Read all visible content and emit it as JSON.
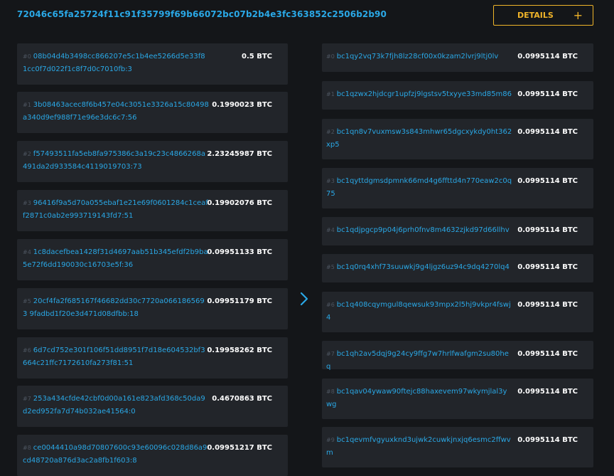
{
  "header": {
    "txid": "72046c65fa25724f11c91f35799f69b66072bc07b2b4e3fc363852c2506b2b90",
    "details_label": "DETAILS",
    "details_plus": "+"
  },
  "inputs": [
    {
      "idx": "#0",
      "ref": "08b04d4b3498cc866207e5c1b4ee5266d5e33f81cc0f7d022f1c8f7d0c7010fb:3",
      "amount": "0.5 BTC"
    },
    {
      "idx": "#1",
      "ref": "3b08463acec8f6b457e04c3051e3326a15c80498a340d9ef988f71e96e3dc6c7:56",
      "amount": "0.1990023 BTC"
    },
    {
      "idx": "#2",
      "ref": "f57493511fa5eb8fa975386c3a19c23c4866268a491da2d933584c4119019703:73",
      "amount": "2.23245987 BTC"
    },
    {
      "idx": "#3",
      "ref": "96416f9a5d70a055ebaf1e21e69f0601284c1ceaff2871c0ab2e993719143fd7:51",
      "amount": "0.19902076 BTC"
    },
    {
      "idx": "#4",
      "ref": "1c8dacefbea1428f31d4697aab51b345efdf2b9ba5e72f6dd190030c16703e5f:36",
      "amount": "0.09951133 BTC"
    },
    {
      "idx": "#5",
      "ref": "20cf4fa2f685167f46682dd30c7720a0661865693 9fadbd1f20e3d471d08dfbb:18",
      "amount": "0.09951179 BTC"
    },
    {
      "idx": "#6",
      "ref": "6d7cd752e301f106f51dd8951f7d18e604532bf3664c21ffc7172610fa273f81:51",
      "amount": "0.19958262 BTC"
    },
    {
      "idx": "#7",
      "ref": "253a434cfde42cbf0d00a161e823afd368c50da9d2ed952fa7d74b032ae41564:0",
      "amount": "0.4670863 BTC"
    },
    {
      "idx": "#8",
      "ref": "ce0044410a98d70807600c93e60096c028d86a9cd48720a876d3ac2a8fb1f603:8",
      "amount": "0.09951217 BTC"
    }
  ],
  "outputs": [
    {
      "idx": "#0",
      "ref": "bc1qy2vq73k7fjh8lz28cf00x0kzam2lvrj9ltj0lv",
      "amount": "0.0995114 BTC"
    },
    {
      "idx": "#1",
      "ref": "bc1qzwx2hjdcgr1upfzj9lgstsv5txyye33md85m86",
      "amount": "0.0995114 BTC"
    },
    {
      "idx": "#2",
      "ref": "bc1qn8v7vuxmsw3s843mhwr65dgcxykdy0ht362xp5",
      "amount": "0.0995114 BTC"
    },
    {
      "idx": "#3",
      "ref": "bc1qyttdgmsdpmnk66md4g6ffttd4n770eaw2c0q75",
      "amount": "0.0995114 BTC"
    },
    {
      "idx": "#4",
      "ref": "bc1qdjpgcp9p04j6prh0fnv8m4632zjkd97d66llhv",
      "amount": "0.0995114 BTC"
    },
    {
      "idx": "#5",
      "ref": "bc1q0rq4xhf73suuwkj9g4ljgz6uz94c9dq4270lq4",
      "amount": "0.0995114 BTC"
    },
    {
      "idx": "#6",
      "ref": "bc1q408cqymgul8qewsuk93mpx2l5hj9vkpr4fswj4",
      "amount": "0.0995114 BTC"
    },
    {
      "idx": "#7",
      "ref": "bc1qh2av5dqj9g24cy9ffg7w7hrlfwafgm2su80heq",
      "amount": "0.0995114 BTC"
    },
    {
      "idx": "#8",
      "ref": "bc1qav04ywaw90ftejc88haxevem97wkymjlal3ywg",
      "amount": "0.0995114 BTC"
    },
    {
      "idx": "#9",
      "ref": "bc1qevmfvgyuxknd3ujwk2cuwkjnxjq6esmc2ffwvm",
      "amount": "0.0995114 BTC"
    }
  ],
  "colors": {
    "accent": "#2aa8e6",
    "button": "#f0b429",
    "card": "#22252a",
    "background": "#141619"
  },
  "icons": {
    "arrow": "chevron-right-icon"
  }
}
